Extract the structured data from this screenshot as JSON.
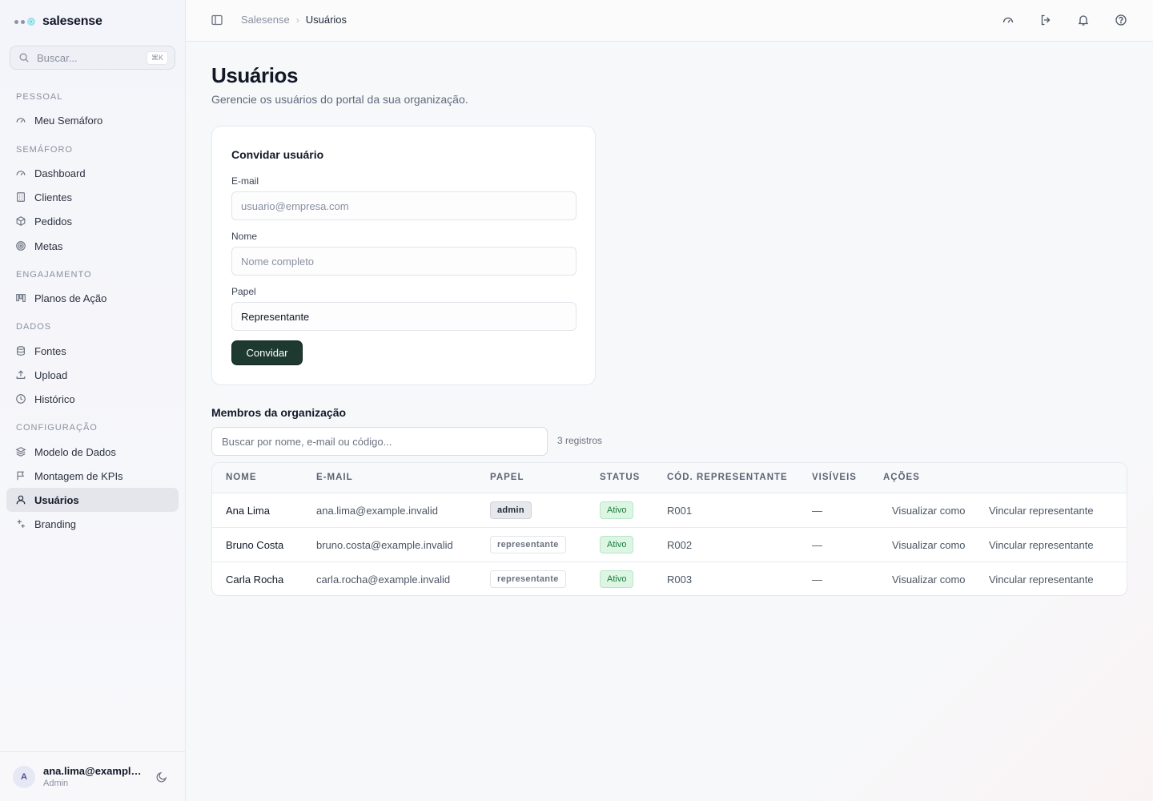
{
  "brand": {
    "name": "salesense"
  },
  "search": {
    "placeholder": "Buscar...",
    "shortcut": "⌘K"
  },
  "sidebar": {
    "sections": [
      {
        "title": "PESSOAL",
        "items": [
          {
            "label": "Meu Semáforo",
            "icon": "gauge-icon"
          }
        ]
      },
      {
        "title": "SEMÁFORO",
        "items": [
          {
            "label": "Dashboard",
            "icon": "gauge-icon"
          },
          {
            "label": "Clientes",
            "icon": "building-icon"
          },
          {
            "label": "Pedidos",
            "icon": "package-icon"
          },
          {
            "label": "Metas",
            "icon": "target-icon"
          }
        ]
      },
      {
        "title": "ENGAJAMENTO",
        "items": [
          {
            "label": "Planos de Ação",
            "icon": "kanban-icon"
          }
        ]
      },
      {
        "title": "DADOS",
        "items": [
          {
            "label": "Fontes",
            "icon": "database-icon"
          },
          {
            "label": "Upload",
            "icon": "upload-icon"
          },
          {
            "label": "Histórico",
            "icon": "clock-icon"
          }
        ]
      },
      {
        "title": "CONFIGURAÇÃO",
        "items": [
          {
            "label": "Modelo de Dados",
            "icon": "layers-icon"
          },
          {
            "label": "Montagem de KPIs",
            "icon": "flag-icon"
          },
          {
            "label": "Usuários",
            "icon": "user-icon",
            "active": true
          },
          {
            "label": "Branding",
            "icon": "sparkle-icon"
          }
        ]
      }
    ]
  },
  "user": {
    "initial": "A",
    "email": "ana.lima@example.invalid",
    "role": "Admin"
  },
  "breadcrumb": {
    "root": "Salesense",
    "separator": "›",
    "current": "Usuários"
  },
  "page": {
    "title": "Usuários",
    "subtitle": "Gerencie os usuários do portal da sua organização."
  },
  "invite": {
    "title": "Convidar usuário",
    "email_label": "E-mail",
    "email_placeholder": "usuario@empresa.com",
    "name_label": "Nome",
    "name_placeholder": "Nome completo",
    "role_label": "Papel",
    "role_value": "Representante",
    "button": "Convidar"
  },
  "members": {
    "title": "Membros da organização",
    "search_placeholder": "Buscar por nome, e-mail ou código...",
    "count": "3 registros",
    "columns": [
      "NOME",
      "E-MAIL",
      "PAPEL",
      "STATUS",
      "CÓD. REPRESENTANTE",
      "VISÍVEIS",
      "AÇÕES"
    ],
    "rows": [
      {
        "name": "Ana Lima",
        "email": "ana.lima@example.invalid",
        "role": "admin",
        "status": "Ativo",
        "code": "R001",
        "visible": "—",
        "action_view": "Visualizar como",
        "action_link": "Vincular representante"
      },
      {
        "name": "Bruno Costa",
        "email": "bruno.costa@example.invalid",
        "role": "representante",
        "status": "Ativo",
        "code": "R002",
        "visible": "—",
        "action_view": "Visualizar como",
        "action_link": "Vincular representante"
      },
      {
        "name": "Carla Rocha",
        "email": "carla.rocha@example.invalid",
        "role": "representante",
        "status": "Ativo",
        "code": "R003",
        "visible": "—",
        "action_view": "Visualizar como",
        "action_link": "Vincular representante"
      }
    ]
  },
  "colors": {
    "accent": "#1e3a30",
    "status_active_bg": "#dcf6e3",
    "status_active_text": "#1c7a3d",
    "brand_dot": "#22c1d6"
  },
  "topbar": {
    "icons": [
      "gauge-icon",
      "logout-icon",
      "bell-icon",
      "help-icon"
    ]
  }
}
